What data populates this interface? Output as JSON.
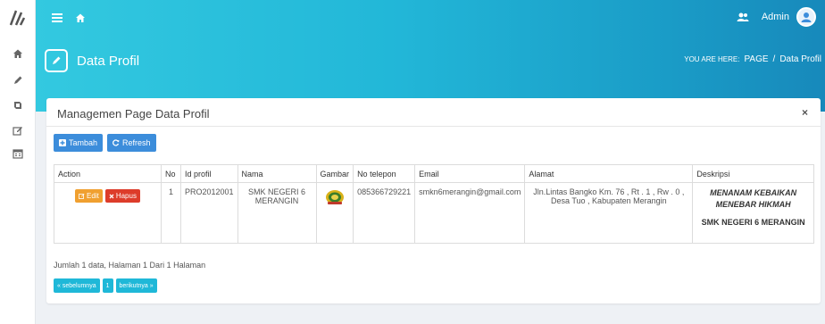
{
  "header": {
    "page_title": "Data Profil",
    "user_name": "Admin",
    "breadcrumb": {
      "prefix": "YOU ARE HERE:",
      "section": "PAGE",
      "separator": "/",
      "current": "Data Profil"
    }
  },
  "panel": {
    "title": "Managemen Page Data Profil",
    "close_label": "×",
    "tambah_label": "Tambah",
    "refresh_label": "Refresh"
  },
  "table": {
    "headers": [
      "Action",
      "No",
      "Id profil",
      "Nama",
      "Gambar",
      "No telepon",
      "Email",
      "Alamat",
      "Deskripsi"
    ],
    "rows": [
      {
        "edit_label": "Edit",
        "hapus_label": "Hapus",
        "no": "1",
        "id_profil": "PRO2012001",
        "nama": "SMK NEGERI 6 MERANGIN",
        "no_telepon": "085366729221",
        "email": "smkn6merangin@gmail.com",
        "alamat": "Jln.Lintas Bangko Km. 76 , Rt . 1 , Rw . 0 , Desa Tuo , Kabupaten Merangin",
        "deskripsi_motto": "MENANAM KEBAIKAN MENEBAR HIKMAH",
        "deskripsi_name": "SMK NEGERI 6 MERANGIN"
      }
    ]
  },
  "footer": {
    "info": "Jumlah 1 data, Halaman 1 Dari 1 Halaman",
    "prev_label": "« sebelumnya",
    "page_label": "1",
    "next_label": "berikutnya »"
  },
  "colors": {
    "header_start": "#33c9e0",
    "header_end": "#1789bb",
    "primary": "#3c8ddb",
    "warning": "#f0a030",
    "danger": "#dd3c2a",
    "pager": "#1fb8d8"
  },
  "icons": [
    "logo-icon",
    "home-icon",
    "pencil-icon",
    "book-icon",
    "edit-icon",
    "calendar-icon",
    "menu-icon",
    "users-icon",
    "plus-icon",
    "refresh-icon",
    "close-icon"
  ]
}
